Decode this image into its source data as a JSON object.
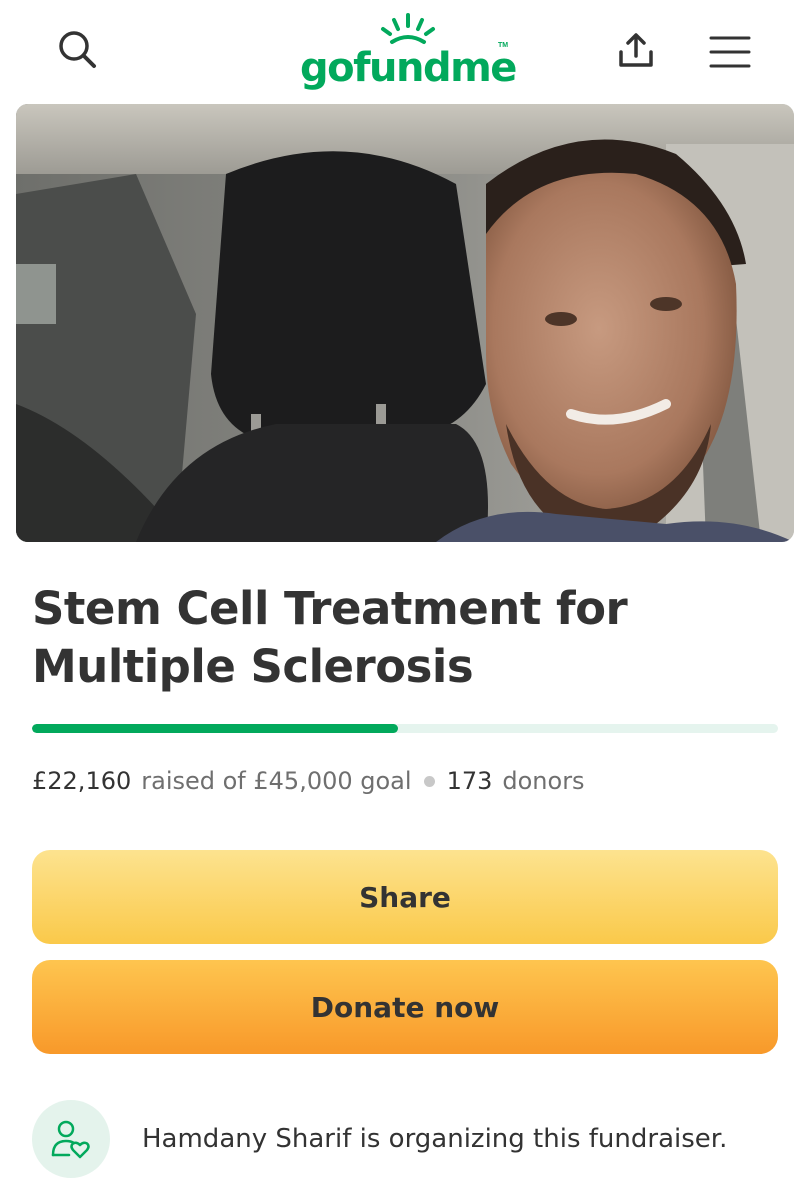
{
  "header": {
    "logo_text": "gofundme",
    "logo_tm": "TM",
    "icons": [
      "search-icon",
      "share-upload-icon",
      "hamburger-menu-icon"
    ]
  },
  "campaign": {
    "title": "Stem Cell Treatment for Multiple Sclerosis",
    "hero_image": "photo of a smiling man with a beard seated in a car",
    "raised": "£22,160",
    "raised_label": "raised of £45,000 goal",
    "donors_count": "173",
    "donors_label": "donors",
    "progress_fraction": 0.49
  },
  "actions": {
    "share_label": "Share",
    "donate_label": "Donate now"
  },
  "organizer": {
    "text": "Hamdany Sharif is organizing this fundraiser.",
    "icon": "organizer-heart-icon"
  },
  "colors": {
    "brand_green": "#02a95c",
    "share_button": "#fbd46b",
    "donate_button": "#fbae3c"
  }
}
